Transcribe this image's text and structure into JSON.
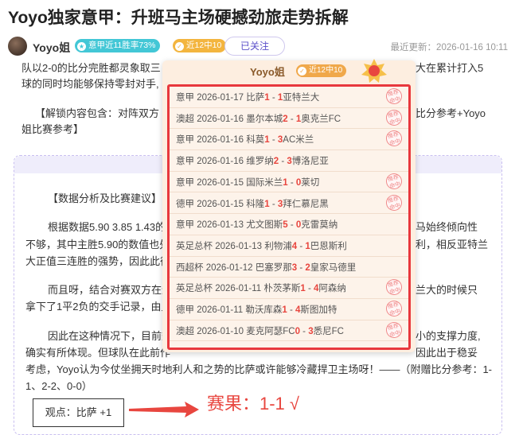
{
  "article": {
    "title": "Yoyo独家意甲：升班马主场硬撼劲旅走势拆解",
    "author": "Yoyo姐",
    "badge_winrate": "意甲近11胜率73%",
    "badge_recent": "近12中10",
    "follow_label": "已关注",
    "updated": "最近更新：2026-01-16 10:11"
  },
  "body": {
    "p1_line1": "队以2-0的比分完胜都灵象取三",
    "p1_line1_tail": "大在累计打入5",
    "p1_line2": "球的同时均能够保持零封对手,",
    "p2_line1": "【解锁内容包含：对阵双方",
    "p2_line1_tail": "比分参考+Yoyo",
    "p2_line2": "姐比赛参考】",
    "section_heading": "【数据分析及比赛建议】",
    "p3_line1": "根据数据5.90 3.85 1.43的",
    "p3_line1_tail": "马始终倾向性",
    "p3_line2": "不够，其中主胜5.90的数值也处",
    "p3_line2_tail": "利，相反亚特兰",
    "p3_line3": "大正值三连胜的强势，因此此征",
    "p4_line1": "而且呀，结合对赛双方在近",
    "p4_line1_tail": "兰大的时候只",
    "p4_line2": "拿下了1平2负的交手记录，由此",
    "p5_line1": "因此在这种情况下，目前数",
    "p5_line1_tail": "小的支撑力度,",
    "p5_line2": "确实有所体现。但球队在此前作",
    "p5_line2_tail": "因此出于稳妥",
    "p5_line3": "考虑，Yoyo认为今仗坐拥天时地利人和之势的比萨或许能够冷藏捍卫主场呀！——（附赠比分参考：1-",
    "p5_line4": "1、2-2、0-0）",
    "viewpoint": "观点：比萨 +1",
    "result": "赛果：1-1 √"
  },
  "popup": {
    "name": "Yoyo姐",
    "tag": "近12中10",
    "matches": [
      {
        "league": "意甲",
        "date": "2026-01-17",
        "home": "比萨",
        "hs": "1",
        "as": "1",
        "away": "亚特兰大",
        "stamp": true
      },
      {
        "league": "澳超",
        "date": "2026-01-16",
        "home": "墨尔本城",
        "hs": "2",
        "as": "1",
        "away": "奥克兰FC",
        "stamp": true
      },
      {
        "league": "意甲",
        "date": "2026-01-16",
        "home": "科莫",
        "hs": "1",
        "as": "3",
        "away": "AC米兰",
        "stamp": true
      },
      {
        "league": "意甲",
        "date": "2026-01-16",
        "home": "维罗纳",
        "hs": "2",
        "as": "3",
        "away": "博洛尼亚",
        "stamp": false
      },
      {
        "league": "意甲",
        "date": "2026-01-15",
        "home": "国际米兰",
        "hs": "1",
        "as": "0",
        "away": "莱切",
        "stamp": true
      },
      {
        "league": "德甲",
        "date": "2026-01-15",
        "home": "科隆",
        "hs": "1",
        "as": "3",
        "away": "拜仁慕尼黑",
        "stamp": true
      },
      {
        "league": "意甲",
        "date": "2026-01-13",
        "home": "尤文图斯",
        "hs": "5",
        "as": "0",
        "away": "克雷莫纳",
        "stamp": false
      },
      {
        "league": "英足总杯",
        "date": "2026-01-13",
        "home": "利物浦",
        "hs": "4",
        "as": "1",
        "away": "巴恩斯利",
        "stamp": false
      },
      {
        "league": "西超杯",
        "date": "2026-01-12",
        "home": "巴塞罗那",
        "hs": "3",
        "as": "2",
        "away": "皇家马德里",
        "stamp": false
      },
      {
        "league": "英足总杯",
        "date": "2026-01-11",
        "home": "朴茨茅斯",
        "hs": "1",
        "as": "4",
        "away": "阿森纳",
        "stamp": true
      },
      {
        "league": "德甲",
        "date": "2026-01-11",
        "home": "勒沃库森",
        "hs": "1",
        "as": "4",
        "away": "斯图加特",
        "stamp": true
      },
      {
        "league": "澳超",
        "date": "2026-01-10",
        "home": "麦克阿瑟FC",
        "hs": "0",
        "as": "3",
        "away": "悉尼FC",
        "stamp": true
      }
    ],
    "stamp_text": "推荐命中"
  },
  "colors": {
    "accent": "#5b4fc9",
    "red": "#e8463f",
    "teal": "#43c7d6",
    "gold": "#f3b53f"
  }
}
